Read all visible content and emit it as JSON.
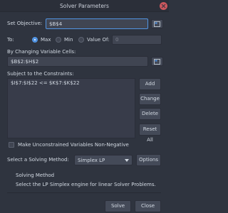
{
  "window": {
    "title": "Solver Parameters"
  },
  "objective": {
    "label": "Set Objective:",
    "value": "$B$4"
  },
  "to": {
    "label": "To:",
    "options": [
      {
        "label": "Max",
        "selected": true
      },
      {
        "label": "Min",
        "selected": false
      },
      {
        "label": "Value Of:",
        "selected": false
      }
    ],
    "value_of": "0"
  },
  "changing": {
    "label": "By Changing Variable Cells:",
    "value": "$B$2:$H$2"
  },
  "constraints": {
    "label": "Subject to the Constraints:",
    "items": [
      "$I$7:$I$22 <= $K$7:$K$22"
    ],
    "buttons": {
      "add": "Add",
      "change": "Change",
      "delete": "Delete",
      "reset": "Reset All"
    }
  },
  "nonneg": {
    "label": "Make Unconstrained Variables Non-Negative",
    "checked": false
  },
  "method": {
    "label": "Select a Solving Method:",
    "value": "Simplex LP",
    "options_button": "Options"
  },
  "method_info": {
    "heading": "Solving Method",
    "description": "Select the LP Simplex engine for linear Solver Problems."
  },
  "footer": {
    "solve": "Solve",
    "close": "Close"
  },
  "colors": {
    "background": "#2f343f",
    "accent": "#5294e2",
    "field": "#404552",
    "close_red": "#cc575d"
  }
}
